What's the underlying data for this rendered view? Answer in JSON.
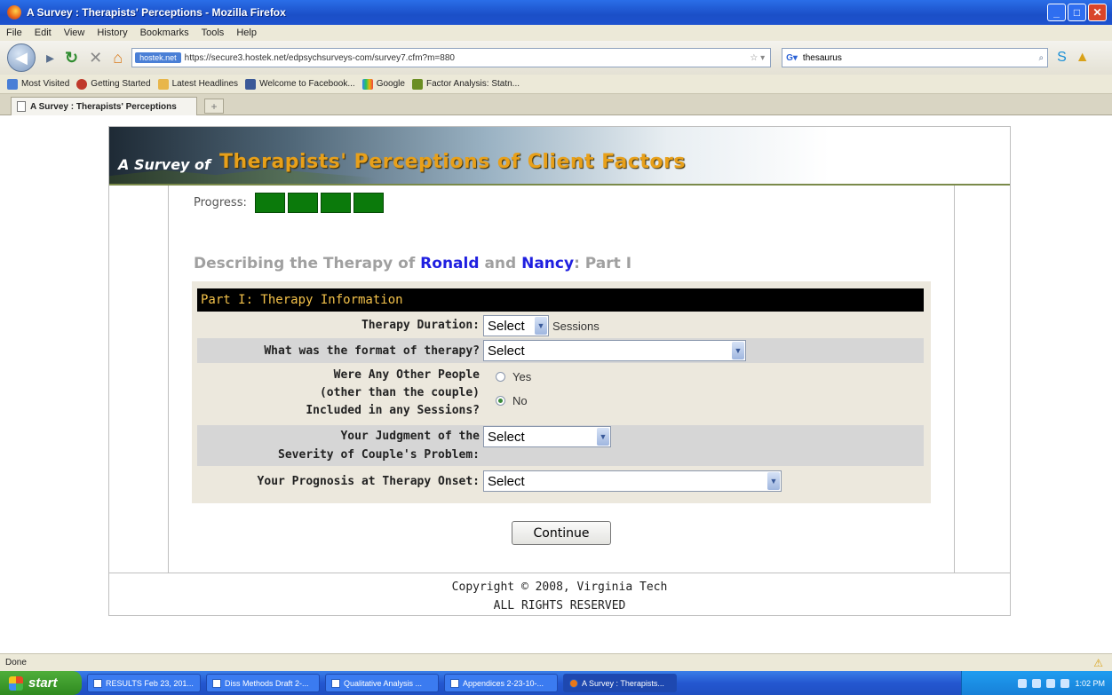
{
  "window": {
    "title": "A Survey : Therapists' Perceptions - Mozilla Firefox"
  },
  "menu": [
    "File",
    "Edit",
    "View",
    "History",
    "Bookmarks",
    "Tools",
    "Help"
  ],
  "nav": {
    "identity": "hostek.net",
    "url": "https://secure3.hostek.net/edpsychsurveys-com/survey7.cfm?m=880",
    "search_value": "thesaurus"
  },
  "bookmarks": [
    "Most Visited",
    "Getting Started",
    "Latest Headlines",
    "Welcome to Facebook...",
    "Google",
    "Factor Analysis: Statn..."
  ],
  "tab": {
    "label": "A Survey : Therapists' Perceptions",
    "new_tab": "+"
  },
  "banner": {
    "prefix": "A Survey of",
    "title": "Therapists' Perceptions of Client Factors"
  },
  "progress": {
    "label": "Progress:",
    "blocks": 4
  },
  "heading": {
    "pre": "Describing the Therapy of",
    "name1": "Ronald",
    "and": "and",
    "name2": "Nancy",
    "suffix": ": Part I"
  },
  "form": {
    "header": "Part I: Therapy Information",
    "duration": {
      "label": "Therapy Duration:",
      "value": "Select",
      "unit": "Sessions"
    },
    "format": {
      "label": "What was the format of therapy?",
      "value": "Select"
    },
    "others": {
      "label_line1": "Were Any Other People",
      "label_line2": "(other than the couple)",
      "label_line3": "Included in any Sessions?",
      "yes": "Yes",
      "no": "No",
      "selected": "No"
    },
    "severity": {
      "label_line1": "Your Judgment of the",
      "label_line2": "Severity of Couple's Problem:",
      "value": "Select"
    },
    "prognosis": {
      "label": "Your Prognosis at Therapy Onset:",
      "value": "Select"
    },
    "continue": "Continue"
  },
  "footer": {
    "line1": "Copyright © 2008, Virginia Tech",
    "line2": "ALL RIGHTS RESERVED"
  },
  "status": {
    "text": "Done"
  },
  "taskbar": {
    "start": "start",
    "tasks": [
      "RESULTS Feb 23, 201...",
      "Diss Methods Draft 2-...",
      "Qualitative Analysis ...",
      "Appendices 2-23-10-...",
      "A Survey : Therapists..."
    ],
    "clock": "1:02 PM"
  },
  "colors": {
    "progress_block": "#0b7a0b",
    "heading_name": "#1f1fe0",
    "form_header_text": "#f4c24a",
    "banner_title": "#e8a01a"
  }
}
